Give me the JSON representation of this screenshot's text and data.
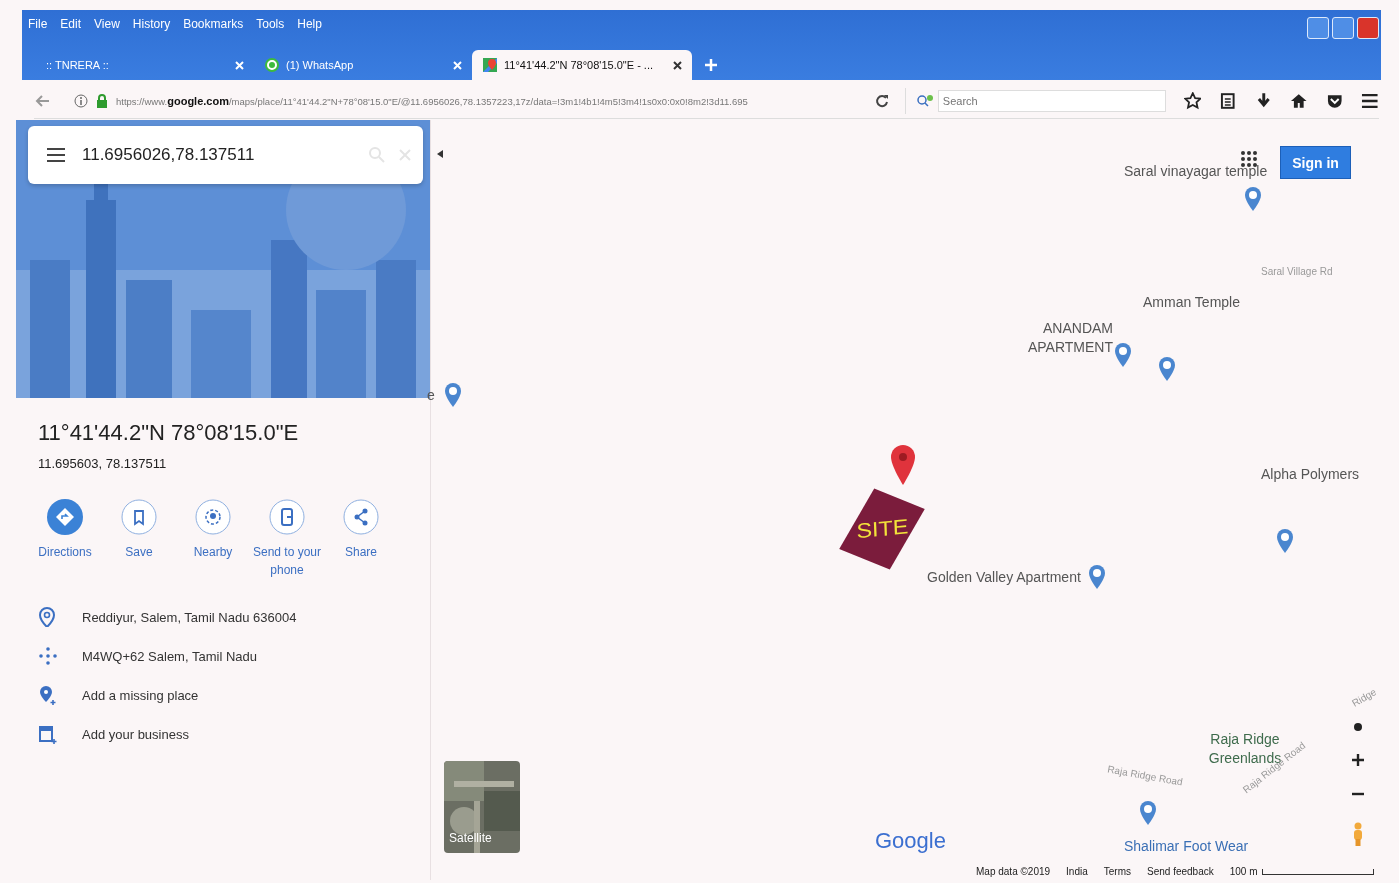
{
  "menu_bar": [
    "File",
    "Edit",
    "View",
    "History",
    "Bookmarks",
    "Tools",
    "Help"
  ],
  "tabs": [
    {
      "title": ":: TNRERA ::",
      "kind": "plain",
      "selected": false
    },
    {
      "title": "(1) WhatsApp",
      "kind": "chat",
      "selected": false
    },
    {
      "title": "11°41'44.2\"N 78°08'15.0\"E - ...",
      "kind": "map",
      "selected": true
    }
  ],
  "address_bar": {
    "url": "https://www.**google.com**/maps/place/11°41'44.2\"N+78°08'15.0\"E/@11.6956026,78.1357223,17z/data=!3m1!4b1!4m5!3m4!1s0x0:0x0!8m2!3d11.695"
  },
  "search_bar": {
    "placeholder": "Search"
  },
  "sidebar": {
    "search_value": "11.6956026,78.137511",
    "title": "11°41'44.2\"N 78°08'15.0\"E",
    "coordinates": "11.695603, 78.137511",
    "actions": [
      {
        "label": "Directions",
        "kind": "primary"
      },
      {
        "label": "Save",
        "kind": "save"
      },
      {
        "label": "Nearby",
        "kind": "nearby"
      },
      {
        "label": "Send to your phone",
        "kind": "phone"
      },
      {
        "label": "Share",
        "kind": "share"
      }
    ],
    "info_rows": [
      {
        "text": "Reddiyur, Salem, Tamil Nadu 636004",
        "kind": "pin"
      },
      {
        "text": "M4WQ+62 Salem, Tamil Nadu",
        "kind": "pluscode"
      },
      {
        "text": "Add a missing place",
        "kind": "addplace"
      },
      {
        "text": "Add your business",
        "kind": "business"
      }
    ]
  },
  "map": {
    "sign_in": "Sign in",
    "layer_toggle": "Satellite",
    "logo": "Google",
    "site_label": "SITE",
    "labels": [
      {
        "text": "Saral vinayagar temple",
        "kind": "place"
      },
      {
        "text": "Saral Village Rd",
        "kind": "road"
      },
      {
        "text": "Amman Temple",
        "kind": "place"
      },
      {
        "text": "ANANDAM APARTMENT",
        "kind": "place"
      },
      {
        "text": "e",
        "kind": "place"
      },
      {
        "text": "Alpha Polymers",
        "kind": "place"
      },
      {
        "text": "Golden Valley Apartment",
        "kind": "place"
      },
      {
        "text": "Ridge",
        "kind": "road"
      },
      {
        "text": "Raja Ridge Greenlands",
        "kind": "area"
      },
      {
        "text": "Raja Ridge Road",
        "kind": "road"
      },
      {
        "text": "Raja Ridge Road",
        "kind": "road"
      },
      {
        "text": "Shalimar Foot Wear",
        "kind": "shop"
      }
    ],
    "footer": [
      "Map data ©2019",
      "India",
      "Terms",
      "Send feedback"
    ],
    "scale": "100 m"
  }
}
